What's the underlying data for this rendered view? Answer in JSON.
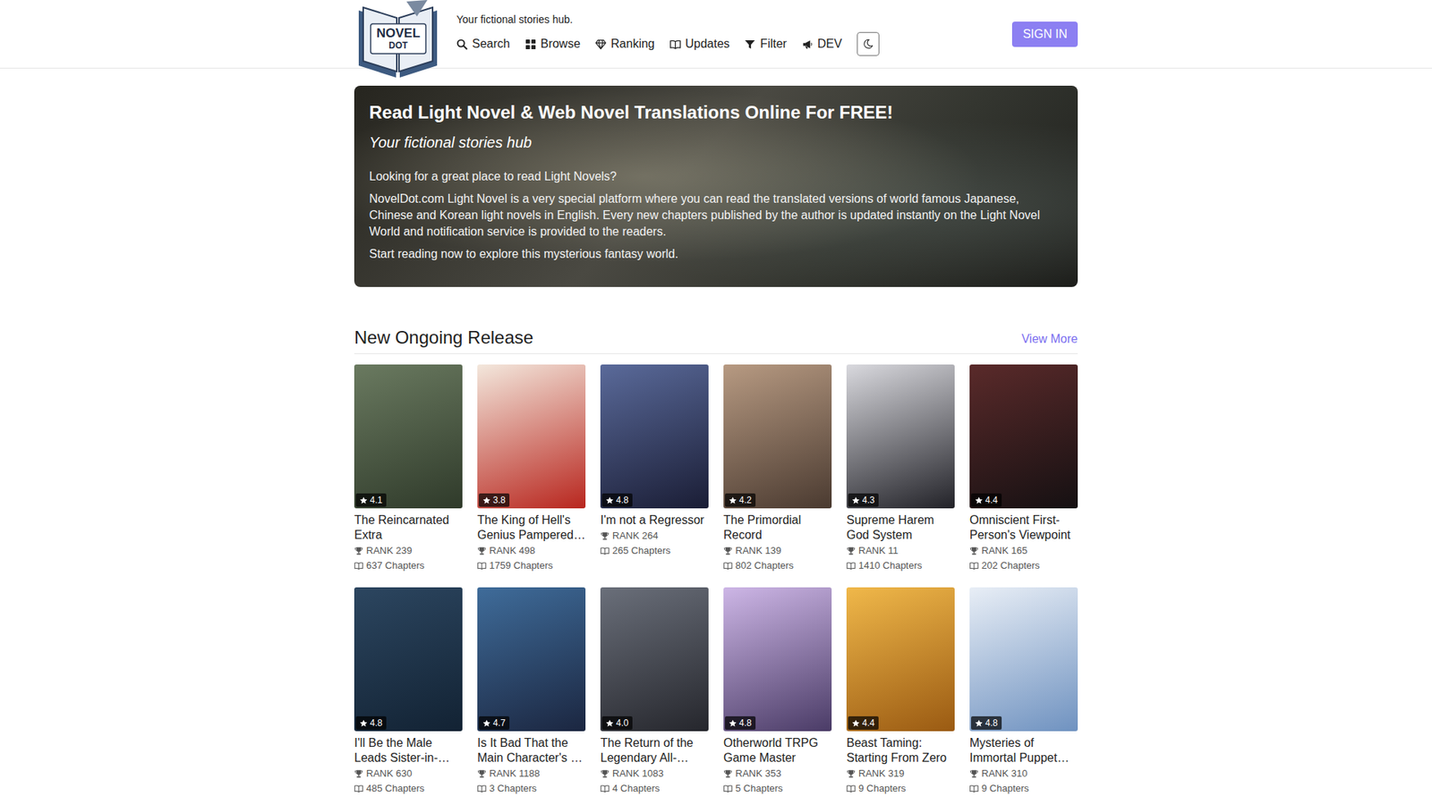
{
  "header": {
    "logo": {
      "top": "NOVEL",
      "bottom": "DOT"
    },
    "tagline": "Your fictional stories hub.",
    "nav": [
      {
        "label": "Search"
      },
      {
        "label": "Browse"
      },
      {
        "label": "Ranking"
      },
      {
        "label": "Updates"
      },
      {
        "label": "Filter"
      },
      {
        "label": "DEV"
      }
    ],
    "sign_in": "SIGN IN"
  },
  "hero": {
    "title": "Read Light Novel & Web Novel Translations Online For FREE!",
    "subtitle": "Your fictional stories hub",
    "paragraphs": [
      "Looking for a great place to read Light Novels?",
      "NovelDot.com Light Novel is a very special platform where you can read the translated versions of world famous Japanese, Chinese and Korean light novels in English. Every new chapters published by the author is updated instantly on the Light Novel World and notification service is provided to the readers.",
      "Start reading now to explore this mysterious fantasy world."
    ]
  },
  "section": {
    "title": "New Ongoing Release",
    "view_more": "View More"
  },
  "novels": [
    {
      "title": "The Reincarnated Extra",
      "rating": "4.1",
      "rank": "RANK 239",
      "chapters": "637 Chapters"
    },
    {
      "title": "The King of Hell's Genius Pampered…",
      "rating": "3.8",
      "rank": "RANK 498",
      "chapters": "1759 Chapters"
    },
    {
      "title": "I'm not a Regressor",
      "rating": "4.8",
      "rank": "RANK 264",
      "chapters": "265 Chapters"
    },
    {
      "title": "The Primordial Record",
      "rating": "4.2",
      "rank": "RANK 139",
      "chapters": "802 Chapters"
    },
    {
      "title": "Supreme Harem God System",
      "rating": "4.3",
      "rank": "RANK 11",
      "chapters": "1410 Chapters"
    },
    {
      "title": "Omniscient First-Person's Viewpoint",
      "rating": "4.4",
      "rank": "RANK 165",
      "chapters": "202 Chapters"
    },
    {
      "title": "I'll Be the Male Leads Sister-in-…",
      "rating": "4.8",
      "rank": "RANK 630",
      "chapters": "485 Chapters"
    },
    {
      "title": "Is It Bad That the Main Character's …",
      "rating": "4.7",
      "rank": "RANK 1188",
      "chapters": "3 Chapters"
    },
    {
      "title": "The Return of the Legendary All-…",
      "rating": "4.0",
      "rank": "RANK 1083",
      "chapters": "4 Chapters"
    },
    {
      "title": "Otherworld TRPG Game Master",
      "rating": "4.8",
      "rank": "RANK 353",
      "chapters": "5 Chapters"
    },
    {
      "title": "Beast Taming: Starting From Zero",
      "rating": "4.4",
      "rank": "RANK 319",
      "chapters": "9 Chapters"
    },
    {
      "title": "Mysteries of Immortal Puppet…",
      "rating": "4.8",
      "rank": "RANK 310",
      "chapters": "9 Chapters"
    }
  ]
}
